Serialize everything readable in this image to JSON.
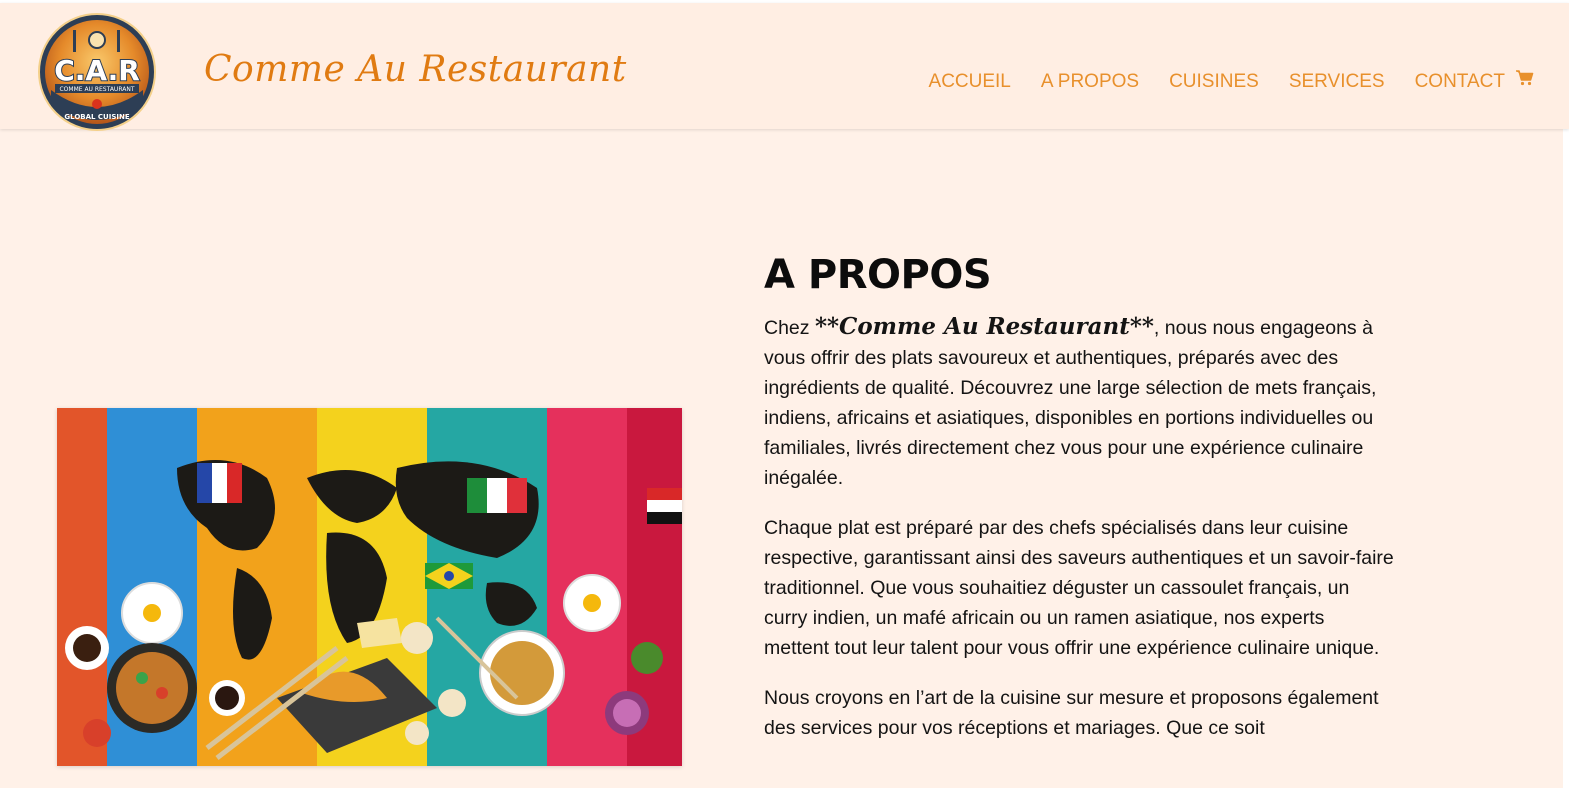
{
  "header": {
    "logo_text": "C.A.R",
    "logo_sub": "COMME AU RESTAURANT",
    "logo_ring": "GLOBAL CUISINE",
    "brand_name": "Comme Au Restaurant",
    "nav": [
      {
        "label": "ACCUEIL"
      },
      {
        "label": "A PROPOS"
      },
      {
        "label": "CUISINES"
      },
      {
        "label": "SERVICES"
      },
      {
        "label": "CONTACT"
      }
    ],
    "cart_icon": "cart-icon"
  },
  "about": {
    "title": "A PROPOS",
    "p1_prefix": "Chez ",
    "p1_brand": "**Comme Au Restaurant**",
    "p1_rest": ", nous nous engageons à vous offrir des plats savoureux et authentiques, préparés avec des ingrédients de qualité. Découvrez une large sélection de mets français, indiens, africains et asiatiques, disponibles en portions individuelles ou familiales, livrés directement chez vous pour une expérience culinaire inégalée.",
    "p2": "Chaque plat est préparé par des chefs spécialisés dans leur cuisine respective, garantissant ainsi des saveurs authentiques et un savoir-faire traditionnel. Que vous souhaitiez déguster un cassoulet français, un curry indien, un mafé africain ou un ramen asiatique, nos experts mettent tout leur talent pour vous offrir une expérience culinaire unique.",
    "p3": "Nous croyons en l’art de la cuisine sur mesure et proposons également des services pour vos réceptions et mariages. Que ce soit"
  },
  "colors": {
    "accent": "#e8902c",
    "brand": "#e07b12",
    "header_bg": "#ffeee3",
    "page_bg": "#fff1e8"
  }
}
